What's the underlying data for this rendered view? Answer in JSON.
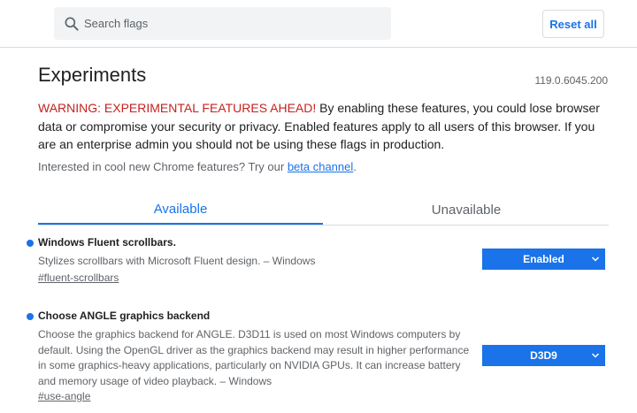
{
  "search": {
    "placeholder": "Search flags"
  },
  "header": {
    "reset_label": "Reset all"
  },
  "page": {
    "title": "Experiments",
    "version": "119.0.6045.200",
    "warning_head": "WARNING: EXPERIMENTAL FEATURES AHEAD!",
    "warning_body": " By enabling these features, you could lose browser data or compromise your security or privacy. Enabled features apply to all users of this browser. If you are an enterprise admin you should not be using these flags in production.",
    "interest_text": "Interested in cool new Chrome features? Try our ",
    "interest_link": "beta channel",
    "interest_end": "."
  },
  "tabs": [
    {
      "label": "Available"
    },
    {
      "label": "Unavailable"
    }
  ],
  "experiments": [
    {
      "name": "Windows Fluent scrollbars.",
      "description": "Stylizes scrollbars with Microsoft Fluent design. – Windows",
      "link": "#fluent-scrollbars",
      "value": "Enabled"
    },
    {
      "name": "Choose ANGLE graphics backend",
      "description": "Choose the graphics backend for ANGLE. D3D11 is used on most Windows computers by default. Using the OpenGL driver as the graphics backend may result in higher performance in some graphics-heavy applications, particularly on NVIDIA GPUs. It can increase battery and memory usage of video playback. – Windows",
      "link": "#use-angle",
      "value": "D3D9"
    }
  ],
  "colors": {
    "accent": "#1a73e8",
    "warning": "#c5221f"
  }
}
